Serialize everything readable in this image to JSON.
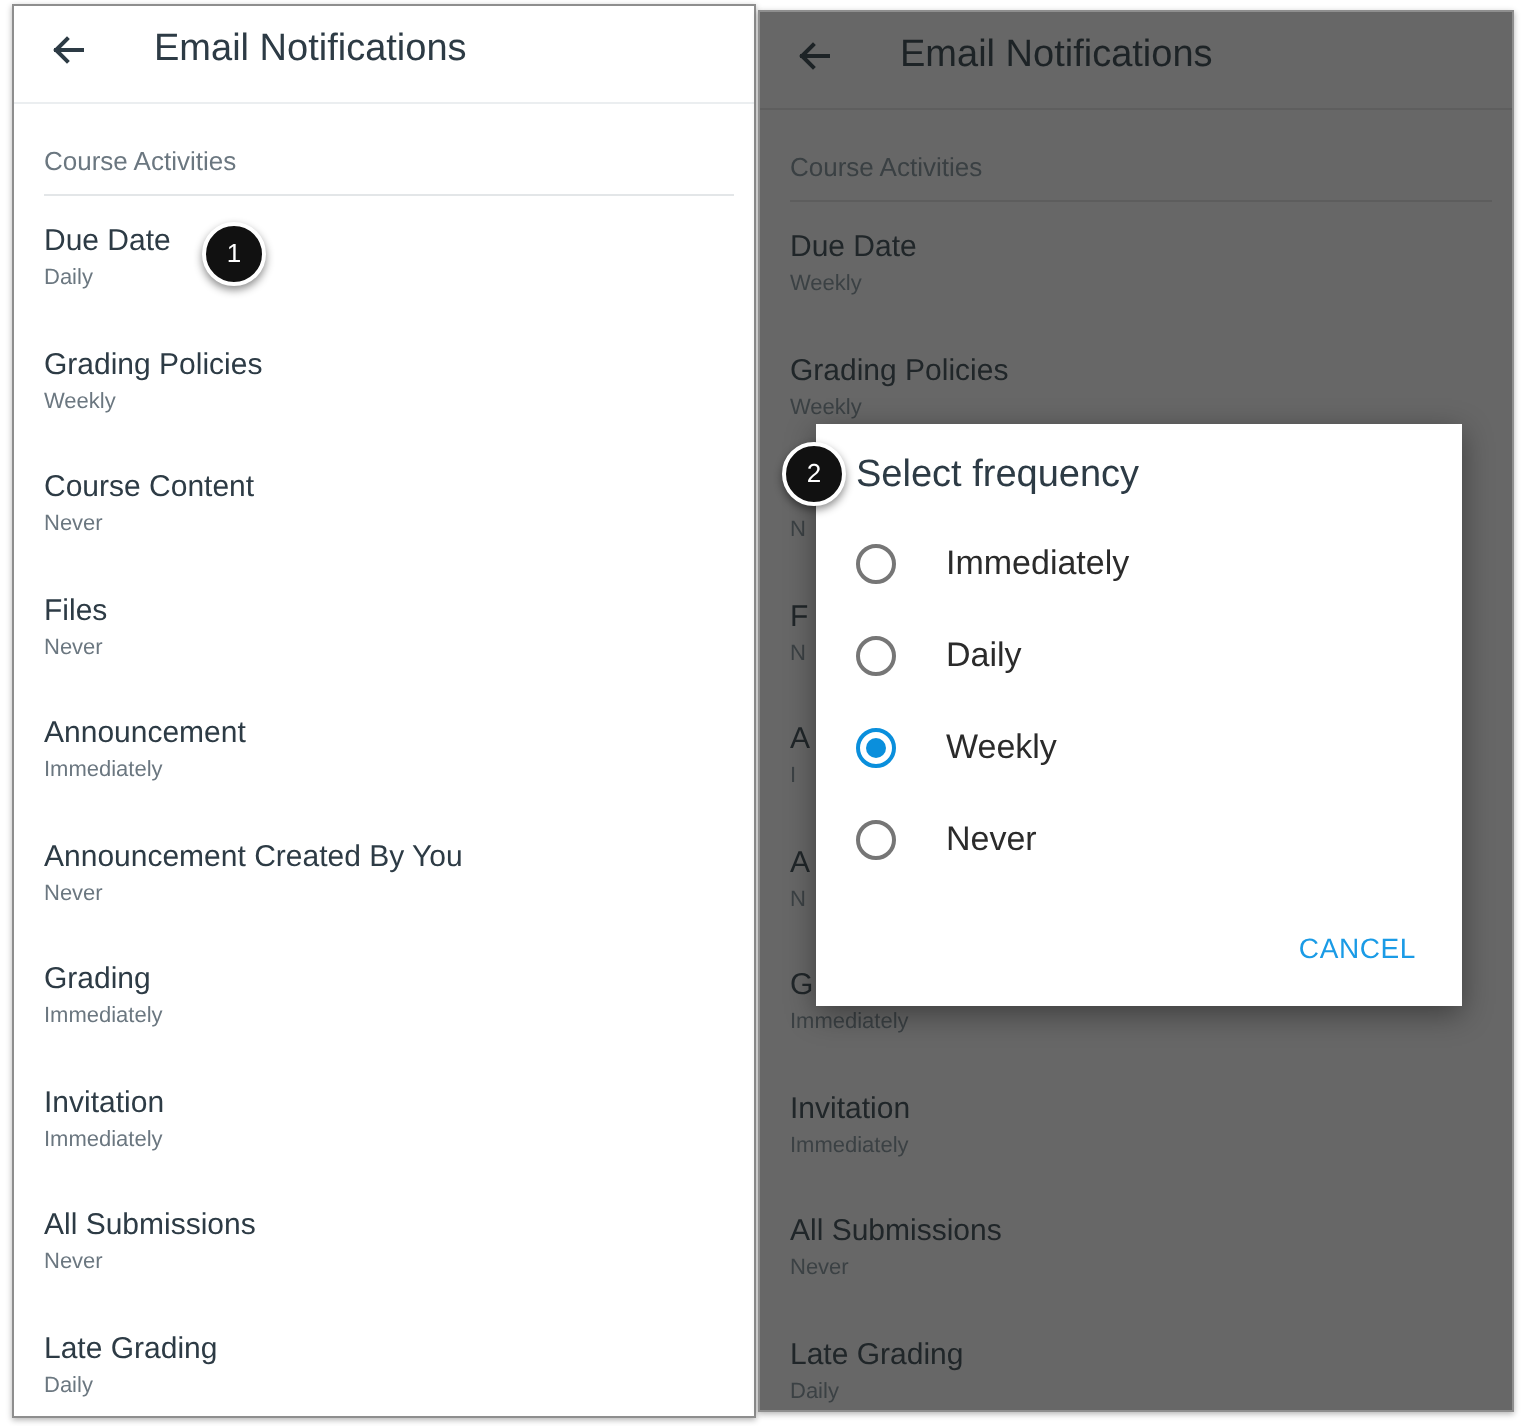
{
  "screens": [
    {
      "dimmed": false,
      "app_bar": {
        "title": "Email Notifications"
      },
      "section_header": "Course Activities",
      "items": [
        {
          "title": "Due Date",
          "frequency": "Daily",
          "callout": "1"
        },
        {
          "title": "Grading Policies",
          "frequency": "Weekly"
        },
        {
          "title": "Course Content",
          "frequency": "Never"
        },
        {
          "title": "Files",
          "frequency": "Never"
        },
        {
          "title": "Announcement",
          "frequency": "Immediately"
        },
        {
          "title": "Announcement Created By You",
          "frequency": "Never"
        },
        {
          "title": "Grading",
          "frequency": "Immediately"
        },
        {
          "title": "Invitation",
          "frequency": "Immediately"
        },
        {
          "title": "All Submissions",
          "frequency": "Never"
        },
        {
          "title": "Late Grading",
          "frequency": "Daily"
        }
      ]
    },
    {
      "dimmed": true,
      "app_bar": {
        "title": "Email Notifications"
      },
      "section_header": "Course Activities",
      "items": [
        {
          "title": "Due Date",
          "frequency": "Weekly"
        },
        {
          "title": "Grading Policies",
          "frequency": "Weekly"
        },
        {
          "frequency": "N"
        },
        {
          "title": "F",
          "frequency": "N"
        },
        {
          "title": "A",
          "frequency": "I"
        },
        {
          "title": "A",
          "frequency": "N"
        },
        {
          "title": "G",
          "frequency": "Immediately"
        },
        {
          "title": "Invitation",
          "frequency": "Immediately"
        },
        {
          "title": "All Submissions",
          "frequency": "Never"
        },
        {
          "title": "Late Grading",
          "frequency": "Daily"
        }
      ],
      "dialog": {
        "title": "Select frequency",
        "callout": "2",
        "options": [
          {
            "label": "Immediately",
            "selected": false
          },
          {
            "label": "Daily",
            "selected": false
          },
          {
            "label": "Weekly",
            "selected": true
          },
          {
            "label": "Never",
            "selected": false
          }
        ],
        "buttons": [
          "CANCEL"
        ]
      }
    }
  ]
}
